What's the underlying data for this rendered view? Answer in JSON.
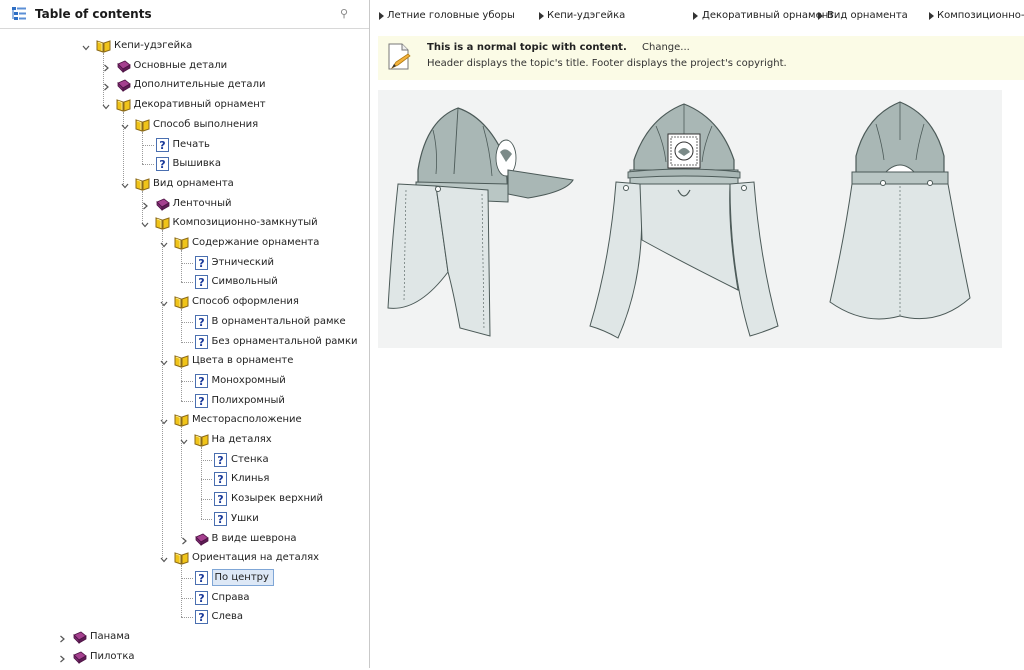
{
  "sidebar": {
    "title": "Table of contents",
    "icon": "toc-icon",
    "pin_glyph": "⚲"
  },
  "tree": [
    {
      "label": "Кепи-удэгейка",
      "type": "book-open",
      "expanded": true,
      "level": 0
    },
    {
      "label": "Основные детали",
      "type": "book-closed",
      "expanded": false,
      "level": 1
    },
    {
      "label": "Дополнительные детали",
      "type": "book-closed",
      "expanded": false,
      "level": 1
    },
    {
      "label": "Декоративный орнамент",
      "type": "book-open",
      "expanded": true,
      "level": 1
    },
    {
      "label": "Способ выполнения",
      "type": "book-open",
      "expanded": true,
      "level": 2
    },
    {
      "label": "Печать",
      "type": "topic",
      "level": 3
    },
    {
      "label": "Вышивка",
      "type": "topic",
      "level": 3
    },
    {
      "label": "Вид орнамента",
      "type": "book-open",
      "expanded": true,
      "level": 2
    },
    {
      "label": "Ленточный",
      "type": "book-closed",
      "expanded": false,
      "level": 3
    },
    {
      "label": "Композиционно-замкнутый",
      "type": "book-open",
      "expanded": true,
      "level": 3
    },
    {
      "label": "Содержание орнамента",
      "type": "book-open",
      "expanded": true,
      "level": 4
    },
    {
      "label": "Этнический",
      "type": "topic",
      "level": 5
    },
    {
      "label": "Символьный",
      "type": "topic",
      "level": 5
    },
    {
      "label": "Способ оформления",
      "type": "book-open",
      "expanded": true,
      "level": 4
    },
    {
      "label": "В орнаментальной рамке",
      "type": "topic",
      "level": 5
    },
    {
      "label": "Без орнаментальной рамки",
      "type": "topic",
      "level": 5
    },
    {
      "label": "Цвета в орнаменте",
      "type": "book-open",
      "expanded": true,
      "level": 4
    },
    {
      "label": "Монохромный",
      "type": "topic",
      "level": 5
    },
    {
      "label": "Полихромный",
      "type": "topic",
      "level": 5
    },
    {
      "label": "Месторасположение",
      "type": "book-open",
      "expanded": true,
      "level": 4
    },
    {
      "label": "На деталях",
      "type": "book-open",
      "expanded": true,
      "level": 5
    },
    {
      "label": "Стенка",
      "type": "topic",
      "level": 6
    },
    {
      "label": "Клинья",
      "type": "topic",
      "level": 6
    },
    {
      "label": "Козырек верхний",
      "type": "topic",
      "level": 6
    },
    {
      "label": "Ушки",
      "type": "topic",
      "level": 6
    },
    {
      "label": "В виде шеврона",
      "type": "book-closed",
      "expanded": false,
      "level": 5
    },
    {
      "label": "Ориентация на деталях",
      "type": "book-open",
      "expanded": true,
      "level": 4
    },
    {
      "label": "По центру",
      "type": "topic",
      "level": 5,
      "selected": true
    },
    {
      "label": "Справа",
      "type": "topic",
      "level": 5
    },
    {
      "label": "Слева",
      "type": "topic",
      "level": 5
    },
    {
      "label": "Панама",
      "type": "book-closed",
      "expanded": false,
      "level": -1
    },
    {
      "label": "Пилотка",
      "type": "book-closed",
      "expanded": false,
      "level": -1
    }
  ],
  "breadcrumb": [
    "Летние головные уборы",
    "Кепи-удэгейка",
    "Декоративный орнамент",
    "Вид орнамента",
    "Композиционно-замкнутый"
  ],
  "notice": {
    "title": "This is a normal topic with content.",
    "change": "Change...",
    "desc": "Header displays the topic's title.  Footer displays the project's copyright.",
    "icon": "page-edit-icon"
  },
  "colors": {
    "book_open_border": "#8b6a1a",
    "book_open_fill": "#f0c419",
    "book_closed": "#7a2a6f",
    "topic_fill": "#ffffff",
    "topic_border": "#4a6fb0",
    "topic_mark": "#1a3a9a",
    "selection_bg": "#dde8f6",
    "selection_border": "#7fa6d6",
    "notice_bg": "#fbfbe6",
    "figure_bg": "#f2f3f3",
    "cap_body": "#a9b7b5",
    "cap_flap": "#dfe6e6"
  }
}
